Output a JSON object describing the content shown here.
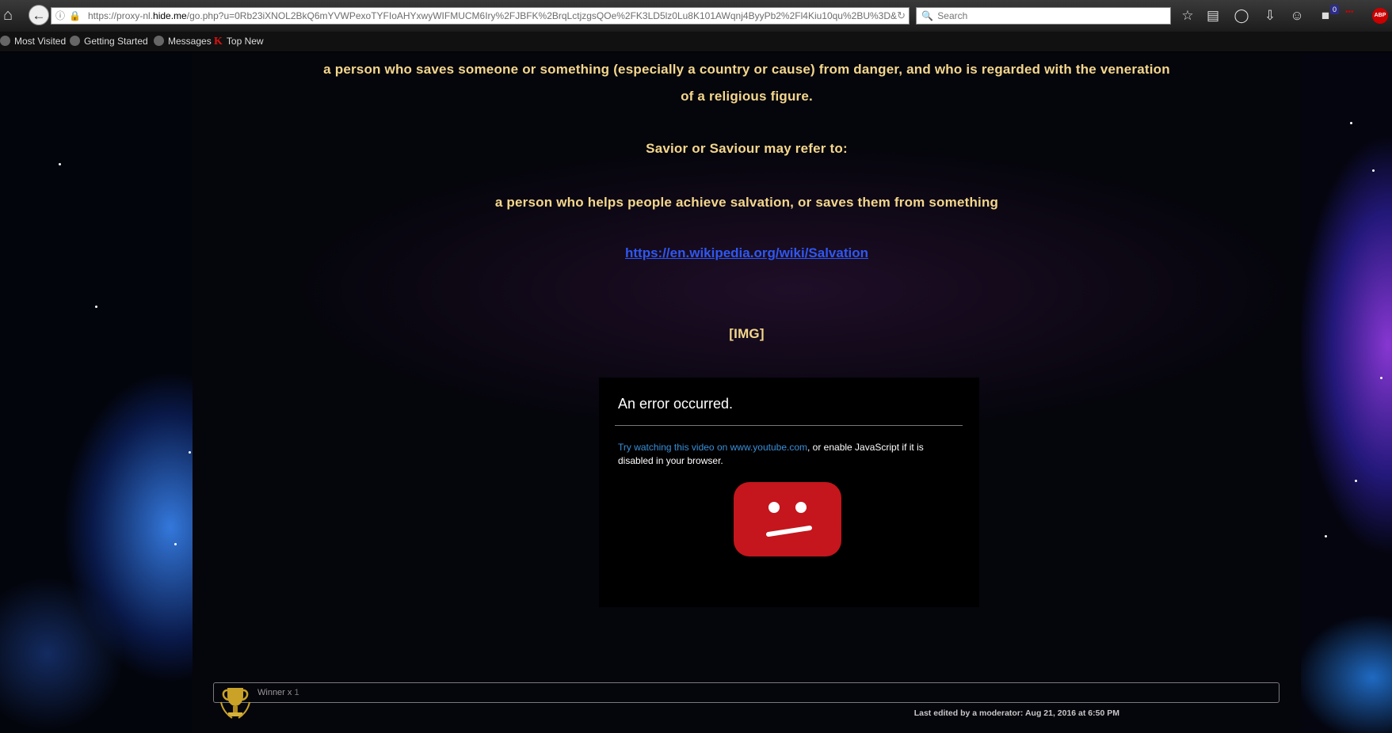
{
  "browser": {
    "url_prefix": "https://proxy-nl.",
    "url_domain": "hide.me",
    "url_suffix": "/go.php?u=0Rb23iXNOL2BkQ6mYVWPexoTYFIoAHYxwyWIFMUCM6Iry%2FJBFK%2BrqLctjzgsQOe%2FK3LD5lz0Lu8K101AWqnj4ByyPb2%2Fl4Kiu10qu%2BU%3D&",
    "search_placeholder": "Search",
    "notification_count": "0",
    "abp_label": "ABP",
    "bookmarks": [
      "Most Visited",
      "Getting Started",
      "Messages",
      "Top New"
    ]
  },
  "post": {
    "line1": "a person who saves someone or something (especially a country or cause) from danger, and who is regarded with the veneration",
    "line2": "of a religious figure.",
    "line3": "Savior or Saviour may refer to:",
    "line4": "a person who helps people achieve salvation, or saves them from something",
    "link": "https://en.wikipedia.org/wiki/Salvation",
    "img_tag": "[IMG]"
  },
  "video_error": {
    "title": "An error occurred.",
    "link_text": "Try watching this video on www.youtube.com",
    "message_rest": ", or enable JavaScript if it is disabled in your browser."
  },
  "footer": {
    "winner_label": "Winner x",
    "winner_count": "1",
    "edited_text": "Last edited by a moderator: Aug 21, 2016 at 6:50 PM"
  },
  "colors": {
    "gold_text": "#f4d78c",
    "link_blue": "#2f57f2",
    "youtube_red": "#c4161c"
  }
}
